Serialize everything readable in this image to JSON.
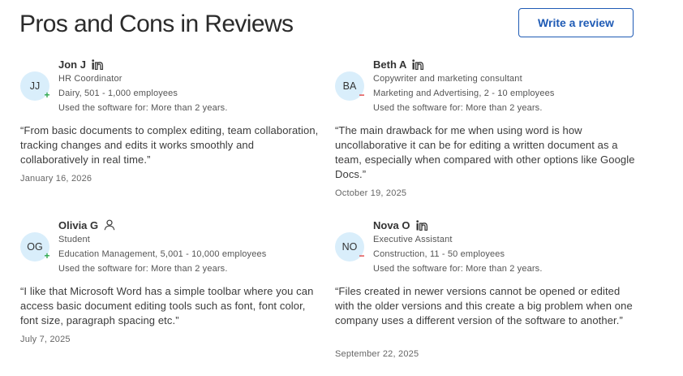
{
  "header": {
    "title": "Pros and Cons in Reviews",
    "write_review_label": "Write a review"
  },
  "colors": {
    "accent": "#1f5bb5",
    "avatar_bg": "#d9eefb",
    "pro": "#2fa84f",
    "con": "#e03b3b"
  },
  "reviews": [
    {
      "initials": "JJ",
      "name": "Jon J",
      "source_icon": "linkedin-icon",
      "sentiment": "pro",
      "sentiment_symbol": "+",
      "role": "HR Coordinator",
      "company": "Dairy, 501 - 1,000 employees",
      "usage": "Used the software for: More than 2 years.",
      "quote": "“From basic documents to complex editing, team collaboration, tracking changes and edits it works smoothly and collaboratively in real time.”",
      "date": "January 16, 2026"
    },
    {
      "initials": "BA",
      "name": "Beth A",
      "source_icon": "linkedin-icon",
      "sentiment": "con",
      "sentiment_symbol": "−",
      "role": "Copywriter and marketing consultant",
      "company": "Marketing and Advertising, 2 - 10 employees",
      "usage": "Used the software for: More than 2 years.",
      "quote": "“The main drawback for me when using word is how uncollaborative it can be for editing a written document as a team, especially when compared with other options like Google Docs.”",
      "date": "October 19, 2025"
    },
    {
      "initials": "OG",
      "name": "Olivia G",
      "source_icon": "user-icon",
      "sentiment": "pro",
      "sentiment_symbol": "+",
      "role": "Student",
      "company": "Education Management, 5,001 - 10,000 employees",
      "usage": "Used the software for: More than 2 years.",
      "quote": "“I like that Microsoft Word has a simple toolbar where you can access basic document editing tools such as font, font color, font size, paragraph spacing etc.”",
      "date": "July 7, 2025"
    },
    {
      "initials": "NO",
      "name": "Nova O",
      "source_icon": "linkedin-icon",
      "sentiment": "con",
      "sentiment_symbol": "−",
      "role": "Executive Assistant",
      "company": "Construction, 11 - 50 employees",
      "usage": "Used the software for: More than 2 years.",
      "quote": "“Files created in newer versions cannot be opened or edited with the older versions and this create a big problem when one company uses a different version of the software to another.”",
      "date": "September 22, 2025"
    }
  ]
}
